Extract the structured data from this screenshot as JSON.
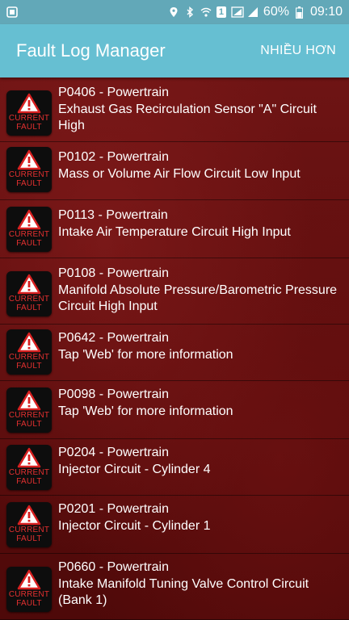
{
  "status_bar": {
    "battery": "60%",
    "time": "09:10",
    "sim_slot": "1"
  },
  "app_bar": {
    "title": "Fault Log Manager",
    "more_label": "NHIỀU HƠN"
  },
  "fault_badge": {
    "line1": "CURRENT",
    "line2": "FAULT"
  },
  "faults": [
    {
      "code": "P0406 - Powertrain",
      "desc": "Exhaust Gas Recirculation Sensor \"A\" Circuit High"
    },
    {
      "code": "P0102 - Powertrain",
      "desc": "Mass or Volume Air Flow Circuit Low Input"
    },
    {
      "code": "P0113 - Powertrain",
      "desc": "Intake Air Temperature Circuit High Input"
    },
    {
      "code": "P0108 - Powertrain",
      "desc": "Manifold Absolute Pressure/Barometric Pressure Circuit High Input"
    },
    {
      "code": "P0642 - Powertrain",
      "desc": "Tap 'Web' for more information"
    },
    {
      "code": "P0098 - Powertrain",
      "desc": "Tap 'Web' for more information"
    },
    {
      "code": "P0204 - Powertrain",
      "desc": "Injector Circuit - Cylinder 4"
    },
    {
      "code": "P0201 - Powertrain",
      "desc": "Injector Circuit - Cylinder 1"
    },
    {
      "code": "P0660 - Powertrain",
      "desc": "Intake Manifold Tuning Valve Control Circuit (Bank 1)"
    }
  ]
}
